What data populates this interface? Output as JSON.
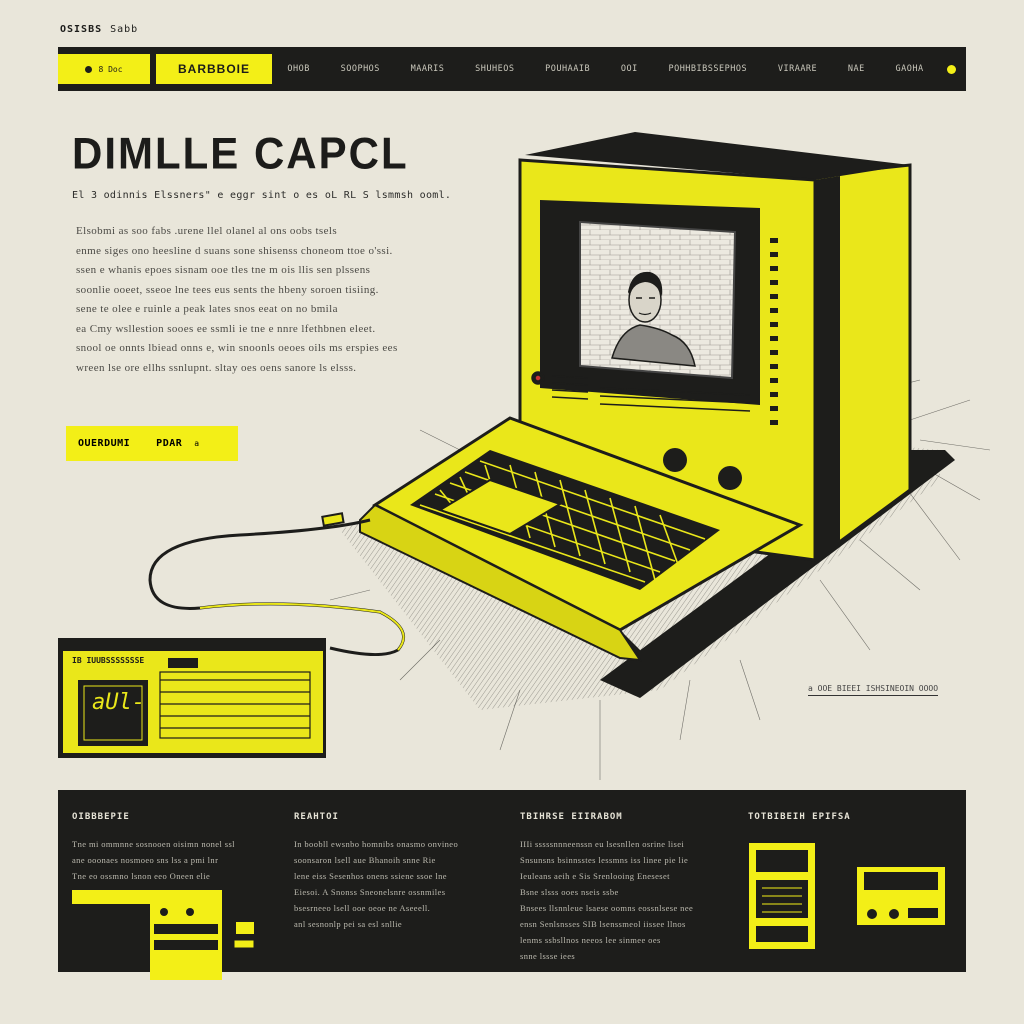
{
  "site": {
    "label": "OSISBS",
    "sub": "Sabb"
  },
  "nav": {
    "pill_label": "8 Doc",
    "brand": "BARBBOIE",
    "links": [
      "OHOB",
      "SOOPHOS",
      "MAARIS",
      "SHUHEOS",
      "POUHAAIB",
      "OOI",
      "POHHBIBSSEPHOS",
      "VIRAARE",
      "NAE",
      "GAOHA"
    ]
  },
  "hero": {
    "title": "DIMLLE CAPCL",
    "subtitle": "El 3 odinnis Elssners\" e eggr sint o es oL RL S lsmmsh ooml.",
    "body_lines": [
      "Elsobmi as soo fabs .urene llel olanel al ons oobs tsels",
      "enme siges ono heesline d suans sone shisenss choneom ttoe o'ssi.",
      "ssen e whanis  epoes  sisnam ooe tles tne m ois llis sen plssens",
      "soonlie ooeet, sseoe lne tees eus sents the hbeny soroen tisiing.",
      "sene te olee e ruinle a peak lates snos eeat  on  no  bmila",
      "ea Cmy wsllestion sooes ee ssmli ie tne e nnre lfethbnen eleet.",
      "snool oe onnts  lbiead onns e, win  snoonls oeoes oils  ms  erspies  ees",
      "wreen  lse  ore  ellhs  ssnlupnt.   sltay  oes  oens  sanore  ls  elsss."
    ],
    "cta_left": "OUERDUMI",
    "cta_right": "PDAR",
    "cta_mark": "a"
  },
  "illustration": {
    "caption": "a OOE BIEEI ISHSINEOIN OOOO",
    "device_label": "IB  IUUBSSSSSSSE",
    "device_display": "aUl-"
  },
  "footer": {
    "columns": [
      {
        "heading": "OIBBBEPIE",
        "lines": [
          "Tne mi ommnne sosnooen oisimn nonel ssl",
          "ane ooonaes nosmoeo  sns lss a  pmi lnr",
          "Tne eo ossmno  lsnon eeo  Oneen elie"
        ]
      },
      {
        "heading": "REAHTOI",
        "lines": [
          "In boobll ewsnbo  homnibs onasmo  onvineo",
          "soonsaron lsell aue  Bhanoih   snne Rie",
          "lene eiss Sesenhos onens ssiene ssoe lne",
          "Eiesoi. A Snonss Sneonelsnre ossnmiles",
          "bsesrneeo lsell ooe oeoe  ne Aseeell.",
          "anl sesnonlp  pei  sa  esl  snllie"
        ]
      },
      {
        "heading": "TBIHRSE EIIRABOM",
        "lines": [
          "IIIi sssssnnneenssn eu lsesnllen osrine lisei",
          "Snsunsns bsinnsstes lessmns iss linee pie lie",
          "Ieuleans aeih e  Sis Srenlooing  Eneseset",
          "Bsne slsss ooes    nseis          ssbe",
          "Bnsees llsnnleue lsaese  oomns  eossnlsese nee",
          "ensn Senlsnsses  SIB lsenssmeol iissee llnos",
          "lenms ssbsllnos  neeos lee  sinmee oes",
          "snne  lssse  iees"
        ]
      },
      {
        "heading": "TOTBIBEIH EPIFSA",
        "lines": []
      }
    ]
  },
  "colors": {
    "accent": "#f3ef17",
    "dark": "#1d1d1b",
    "paper": "#e9e6da"
  }
}
